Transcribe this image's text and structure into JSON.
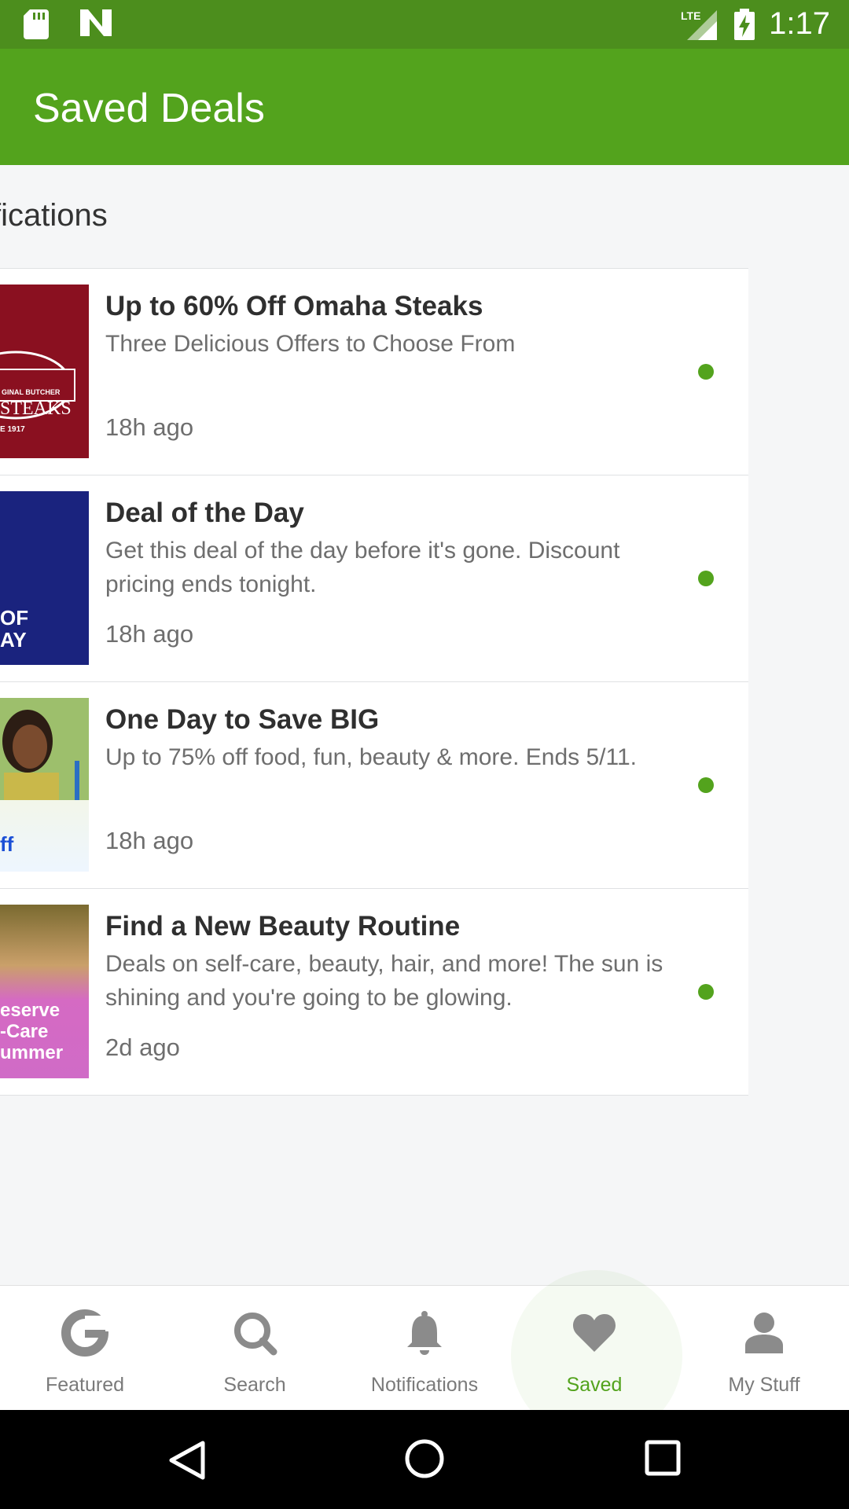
{
  "status_bar": {
    "time": "1:17",
    "network": "LTE",
    "icons": [
      "sd-card-icon",
      "n-logo-icon",
      "signal-icon",
      "battery-charging-icon"
    ]
  },
  "app_bar": {
    "title": "Saved Deals"
  },
  "section": {
    "title": "fications"
  },
  "deals": [
    {
      "title": "Up to 60% Off Omaha Steaks",
      "description": "Three Delicious Offers to Choose From",
      "time": "18h ago",
      "thumb_text": [
        "GINAL BUTCHER",
        "STEAKS",
        "E 1917"
      ]
    },
    {
      "title": "Deal of the Day",
      "description": "Get this deal of the day before it's gone. Discount pricing ends tonight.",
      "time": "18h ago",
      "thumb_text": [
        "OF",
        "AY"
      ]
    },
    {
      "title": "One Day to Save BIG",
      "description": "Up to 75% off food, fun, beauty & more. Ends 5/11.",
      "time": "18h ago",
      "thumb_text": [
        "ff"
      ]
    },
    {
      "title": "Find a New Beauty Routine",
      "description": "Deals on self-care, beauty, hair, and more! The sun is shining and you're going to be glowing.",
      "time": "2d ago",
      "thumb_text": [
        "eserve",
        "-Care",
        "ummer"
      ]
    }
  ],
  "bottom_nav": [
    {
      "label": "Featured",
      "icon": "groupon-g-icon",
      "active": false
    },
    {
      "label": "Search",
      "icon": "search-icon",
      "active": false
    },
    {
      "label": "Notifications",
      "icon": "bell-icon",
      "active": false
    },
    {
      "label": "Saved",
      "icon": "heart-icon",
      "active": true
    },
    {
      "label": "My Stuff",
      "icon": "person-icon",
      "active": false
    }
  ],
  "colors": {
    "app_bar": "#53a31d",
    "status_bar": "#4c8e1d",
    "accent": "#53a31d",
    "unread_dot": "#53a31d"
  }
}
